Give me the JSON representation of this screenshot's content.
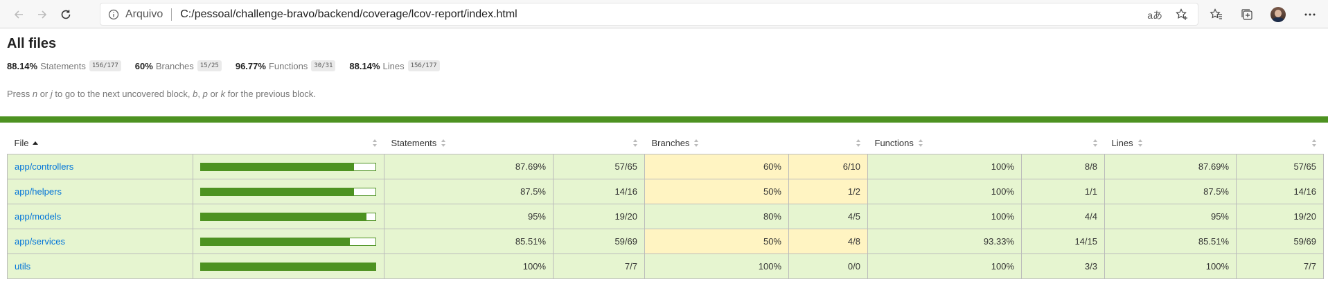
{
  "browser": {
    "site_label": "Arquivo",
    "url": "C:/pessoal/challenge-bravo/backend/coverage/lcov-report/index.html",
    "read_aloud_glyph": "aあ"
  },
  "page": {
    "title": "All files",
    "summary": [
      {
        "pct": "88.14%",
        "label": "Statements",
        "frac": "156/177"
      },
      {
        "pct": "60%",
        "label": "Branches",
        "frac": "15/25"
      },
      {
        "pct": "96.77%",
        "label": "Functions",
        "frac": "30/31"
      },
      {
        "pct": "88.14%",
        "label": "Lines",
        "frac": "156/177"
      }
    ],
    "hint": {
      "p1": "Press ",
      "k1": "n",
      "p2": " or ",
      "k2": "j",
      "p3": " to go to the next uncovered block, ",
      "k3": "b",
      "p4": ", ",
      "k4": "p",
      "p5": " or ",
      "k5": "k",
      "p6": " for the previous block."
    }
  },
  "table": {
    "headers": {
      "file": "File",
      "statements": "Statements",
      "branches": "Branches",
      "functions": "Functions",
      "lines": "Lines"
    },
    "rows": [
      {
        "file": "app/controllers",
        "bar": 0.8769,
        "st_pct": "87.69%",
        "st_frac": "57/65",
        "br_pct": "60%",
        "br_frac": "6/10",
        "br_level": "medium",
        "fn_pct": "100%",
        "fn_frac": "8/8",
        "ln_pct": "87.69%",
        "ln_frac": "57/65"
      },
      {
        "file": "app/helpers",
        "bar": 0.875,
        "st_pct": "87.5%",
        "st_frac": "14/16",
        "br_pct": "50%",
        "br_frac": "1/2",
        "br_level": "medium",
        "fn_pct": "100%",
        "fn_frac": "1/1",
        "ln_pct": "87.5%",
        "ln_frac": "14/16"
      },
      {
        "file": "app/models",
        "bar": 0.95,
        "st_pct": "95%",
        "st_frac": "19/20",
        "br_pct": "80%",
        "br_frac": "4/5",
        "br_level": "high",
        "fn_pct": "100%",
        "fn_frac": "4/4",
        "ln_pct": "95%",
        "ln_frac": "19/20"
      },
      {
        "file": "app/services",
        "bar": 0.8551,
        "st_pct": "85.51%",
        "st_frac": "59/69",
        "br_pct": "50%",
        "br_frac": "4/8",
        "br_level": "medium",
        "fn_pct": "93.33%",
        "fn_frac": "14/15",
        "ln_pct": "85.51%",
        "ln_frac": "59/69"
      },
      {
        "file": "utils",
        "bar": 1.0,
        "st_pct": "100%",
        "st_frac": "7/7",
        "br_pct": "100%",
        "br_frac": "0/0",
        "br_level": "high",
        "fn_pct": "100%",
        "fn_frac": "3/3",
        "ln_pct": "100%",
        "ln_frac": "7/7"
      }
    ]
  },
  "colors": {
    "high": "#e6f5d0",
    "medium": "#fff4c2",
    "bar": "#4d9221",
    "link": "#0074d9"
  }
}
